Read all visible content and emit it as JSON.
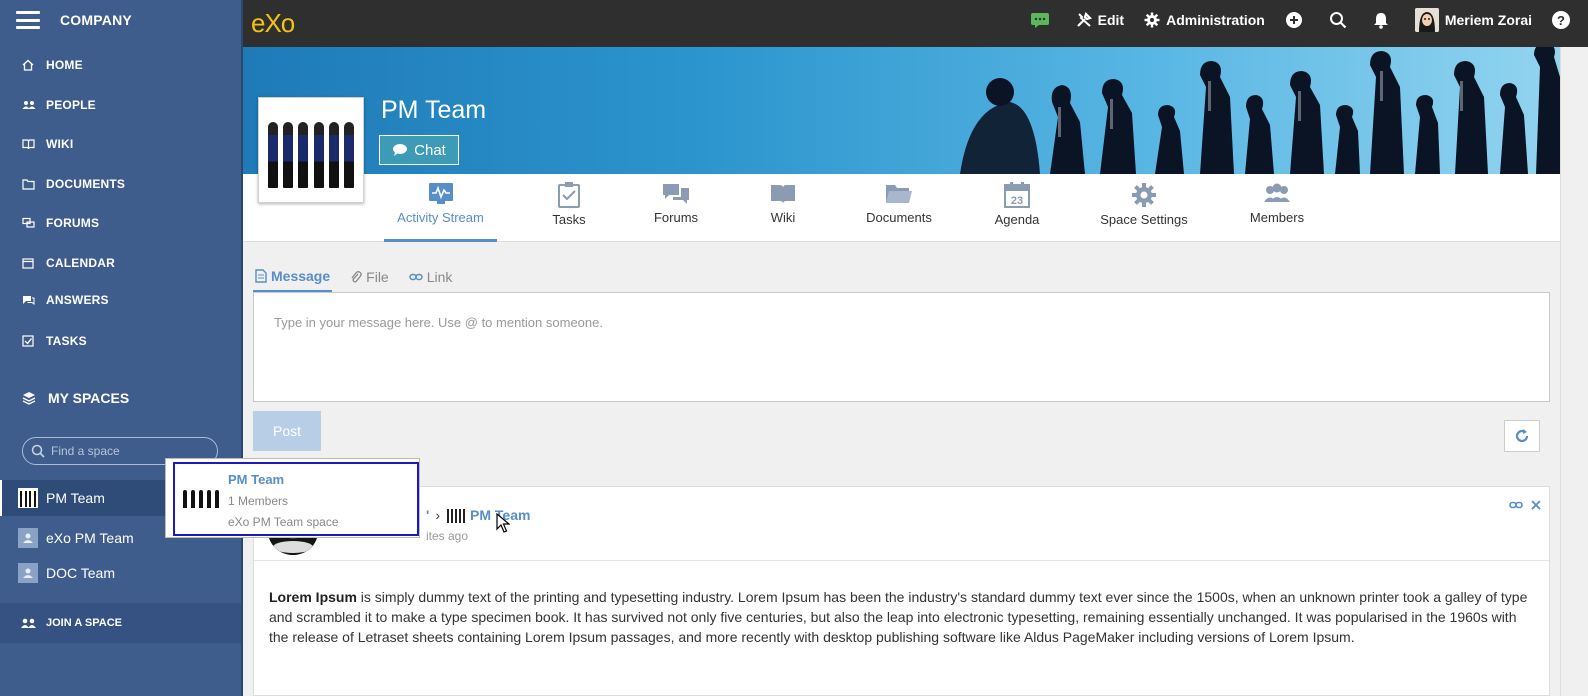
{
  "sidebar": {
    "company": "COMPANY",
    "nav": [
      {
        "label": "HOME",
        "icon": "home-icon"
      },
      {
        "label": "PEOPLE",
        "icon": "people-icon"
      },
      {
        "label": "WIKI",
        "icon": "wiki-icon"
      },
      {
        "label": "DOCUMENTS",
        "icon": "folder-icon"
      },
      {
        "label": "FORUMS",
        "icon": "forums-icon"
      },
      {
        "label": "CALENDAR",
        "icon": "calendar-icon"
      },
      {
        "label": "ANSWERS",
        "icon": "answers-icon"
      },
      {
        "label": "TASKS",
        "icon": "tasks-icon"
      }
    ],
    "my_spaces": "MY SPACES",
    "find_placeholder": "Find a space",
    "spaces": [
      {
        "label": "PM Team",
        "active": true
      },
      {
        "label": "eXo PM Team",
        "active": false
      },
      {
        "label": "DOC Team",
        "active": false
      }
    ],
    "join": "JOIN A SPACE"
  },
  "topbar": {
    "logo": "eXo",
    "edit": "Edit",
    "administration": "Administration",
    "user": "Meriem Zorai",
    "help": "?",
    "colors": {
      "chat_indicator": "#5cb85c",
      "logo": "#f1c40f"
    }
  },
  "space": {
    "title": "PM Team",
    "chat_label": "Chat",
    "tabs": [
      {
        "label": "Activity Stream",
        "icon": "activity-icon",
        "active": true
      },
      {
        "label": "Tasks",
        "icon": "tasks-icon",
        "active": false
      },
      {
        "label": "Forums",
        "icon": "forums-icon",
        "active": false
      },
      {
        "label": "Wiki",
        "icon": "wiki-icon",
        "active": false
      },
      {
        "label": "Documents",
        "icon": "folder-icon",
        "active": false
      },
      {
        "label": "Agenda",
        "icon": "calendar-icon",
        "active": false,
        "badge": "23"
      },
      {
        "label": "Space Settings",
        "icon": "gear-icon",
        "active": false
      },
      {
        "label": "Members",
        "icon": "members-icon",
        "active": false
      }
    ]
  },
  "composer": {
    "tabs": [
      "Message",
      "File",
      "Link"
    ],
    "placeholder": "Type in your message here. Use @ to mention someone.",
    "post": "Post"
  },
  "activity": {
    "author_partial": "'",
    "space_name": "PM Team",
    "time_partial": "ites ago",
    "body_bold": "Lorem Ipsum",
    "body_rest": " is simply dummy text of the printing and typesetting industry. Lorem Ipsum has been the industry's standard dummy text ever since the 1500s, when an unknown printer took a galley of type and scrambled it to make a type specimen book. It has survived not only five centuries, but also the leap into electronic typesetting, remaining essentially unchanged. It was popularised in the 1960s with the release of Letraset sheets containing Lorem Ipsum passages, and more recently with desktop publishing software like Aldus PageMaker including versions of Lorem Ipsum."
  },
  "popover": {
    "title": "PM Team",
    "members": "1 Members",
    "description": "eXo PM Team space"
  }
}
